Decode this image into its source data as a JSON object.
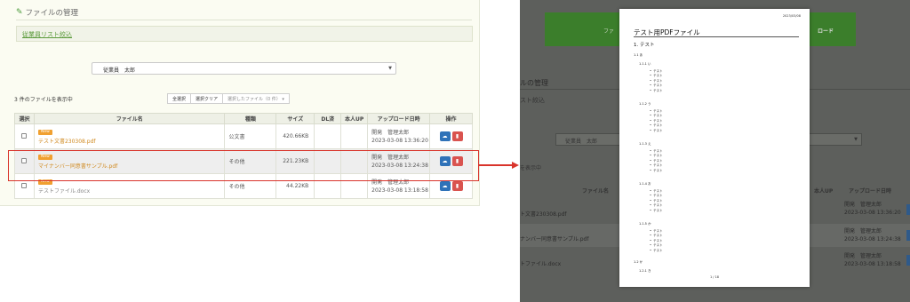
{
  "left": {
    "header_title": "ファイルの管理",
    "filter_link": "従業員リスト絞込",
    "employee_select": "従業員　太郎",
    "count_text": "3 件のファイルを表示中",
    "buttons": {
      "select_all": "全選択",
      "clear_selection": "選択クリア",
      "selected_files": "選択したファイル（0 件）"
    },
    "table": {
      "headers": {
        "select": "選択",
        "filename": "ファイル名",
        "kind": "種類",
        "size": "サイズ",
        "dl_done": "DL済",
        "self_up": "本人UP",
        "uploaded": "アップロード日時",
        "ops": "操作"
      },
      "rows": [
        {
          "badge": "New",
          "filename": "テスト文書230308.pdf",
          "kind": "公文書",
          "size": "420.66KB",
          "uploader": "開発　管理太郎",
          "datetime": "2023-03-08 13:36:20"
        },
        {
          "badge": "New",
          "filename": "マイナンバー同意書サンプル.pdf",
          "kind": "その他",
          "size": "221.23KB",
          "uploader": "開発　管理太郎",
          "datetime": "2023-03-08 13:24:38"
        },
        {
          "badge": "New",
          "filename": "テストファイル.docx",
          "kind": "その他",
          "size": "44.22KB",
          "uploader": "開発　管理太郎",
          "datetime": "2023-03-08 13:18:58"
        }
      ]
    },
    "icons": {
      "pencil": "pencil-icon",
      "caret": "caret-down-icon",
      "download": "cloud-download-icon",
      "delete": "trash-icon"
    },
    "colors": {
      "accent_green": "#4a9a3a",
      "highlight_red": "#d9342b",
      "download_blue": "#2f72b8",
      "delete_red": "#d9534f",
      "badge_orange": "#f0a030"
    }
  },
  "right": {
    "green_text_1": "ファ",
    "green_text_2": "ロード",
    "header_partial": "ルの管理",
    "filter_partial": "スト絞込",
    "employee_select": "従業員　太郎",
    "count_partial": "を表示中",
    "th_filename": "ファイル名",
    "th_self_up": "本人UP",
    "th_uploaded": "アップロード日時",
    "rows": [
      {
        "filename": "ト文書230308.pdf",
        "uploader": "開発　管理太郎",
        "datetime": "2023-03-08 13:36:20"
      },
      {
        "filename": "ナンバー同意書サンプル.pdf",
        "uploader": "開発　管理太郎",
        "datetime": "2023-03-08 13:24:38"
      },
      {
        "filename": "トファイル.docx",
        "uploader": "開発　管理太郎",
        "datetime": "2023-03-08 13:18:58"
      }
    ],
    "pdf": {
      "date": "2023/03/08",
      "title": "テスト用PDFファイル",
      "h1": "1. テスト",
      "s11": "1.1 あ",
      "s111": "1.1.1 い",
      "s112": "1.1.2 う",
      "s113": "1.1.3 え",
      "s114": "1.1.4 お",
      "s115": "1.1.5 か",
      "s12": "1.2 か",
      "s121": "1.2.1 き",
      "item": "テスト",
      "page": "1 / 18"
    }
  }
}
